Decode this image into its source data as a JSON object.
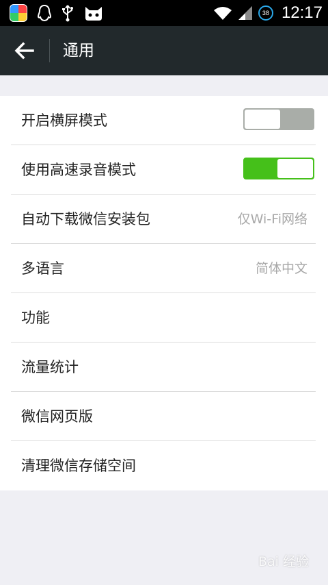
{
  "status_bar": {
    "time": "12:17",
    "battery_level": "38",
    "icons": [
      "app-store-icon",
      "qq-penguin-icon",
      "usb-icon",
      "cat-icon",
      "wifi-icon",
      "signal-icon",
      "battery-icon"
    ]
  },
  "header": {
    "title": "通用",
    "back_icon": "arrow-left-icon"
  },
  "settings": {
    "items": [
      {
        "label": "开启横屏模式",
        "type": "toggle",
        "on": false
      },
      {
        "label": "使用高速录音模式",
        "type": "toggle",
        "on": true
      },
      {
        "label": "自动下载微信安装包",
        "type": "value",
        "value": "仅Wi-Fi网络"
      },
      {
        "label": "多语言",
        "type": "value",
        "value": "简体中文"
      },
      {
        "label": "功能",
        "type": "link"
      },
      {
        "label": "流量统计",
        "type": "link"
      },
      {
        "label": "微信网页版",
        "type": "link"
      },
      {
        "label": "清理微信存储空间",
        "type": "link"
      }
    ]
  },
  "colors": {
    "header_bg": "#22292c",
    "toggle_on": "#45c01a",
    "toggle_off": "#a9ada8",
    "page_bg": "#efeff4"
  },
  "watermark": "Bai 经验"
}
